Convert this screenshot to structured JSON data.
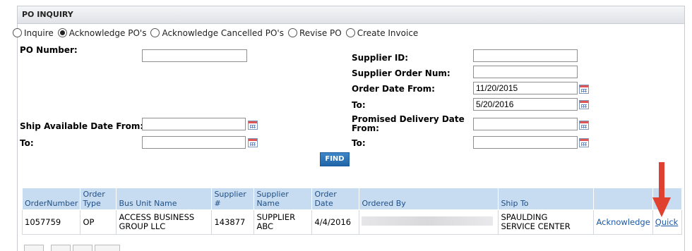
{
  "panel": {
    "title": "PO INQUIRY"
  },
  "radios": [
    {
      "label": "Inquire",
      "selected": false
    },
    {
      "label": "Acknowledge PO's",
      "selected": true
    },
    {
      "label": "Acknowledge Cancelled PO's",
      "selected": false
    },
    {
      "label": "Revise PO",
      "selected": false
    },
    {
      "label": "Create Invoice",
      "selected": false
    }
  ],
  "form": {
    "po_number_label": "PO Number:",
    "po_number_value": "",
    "ship_from_label": "Ship Available Date From:",
    "ship_from_value": "",
    "ship_to_label": "To:",
    "ship_to_value": "",
    "supplier_id_label": "Supplier ID:",
    "supplier_id_value": "",
    "supplier_order_label": "Supplier Order Num:",
    "supplier_order_value": "",
    "order_date_from_label": "Order Date From:",
    "order_date_from_value": "11/20/2015",
    "order_date_to_label": "To:",
    "order_date_to_value": "5/20/2016",
    "promised_label_1": "Promised Delivery Date",
    "promised_label_2": "From:",
    "promised_from_value": "",
    "promised_to_label": "To:",
    "promised_to_value": "",
    "find_label": "FIND"
  },
  "table": {
    "headers": {
      "order_number": "OrderNumber",
      "order_type_1": "Order",
      "order_type_2": "Type",
      "bus_unit": "Bus Unit Name",
      "supplier_num_1": "Supplier",
      "supplier_num_2": "#",
      "supplier_name_1": "Supplier",
      "supplier_name_2": "Name",
      "order_date": "Order Date",
      "ordered_by": "Ordered By",
      "ship_to": "Ship To",
      "action1": "",
      "action2": ""
    },
    "rows": [
      {
        "order_number": "1057759",
        "order_type": "OP",
        "bus_unit_1": "ACCESS BUSINESS",
        "bus_unit_2": "GROUP LLC",
        "supplier_num": "143877",
        "supplier_name_1": "SUPPLIER",
        "supplier_name_2": "ABC",
        "order_date": "4/4/2016",
        "ordered_by": "",
        "ship_to_1": "SPAULDING",
        "ship_to_2": "SERVICE CENTER",
        "acknowledge": "Acknowledge",
        "quick": "Quick"
      }
    ]
  },
  "colors": {
    "accent_blue": "#1f64a8",
    "header_bg": "#c7dcf0",
    "arrow_red": "#e04030"
  }
}
